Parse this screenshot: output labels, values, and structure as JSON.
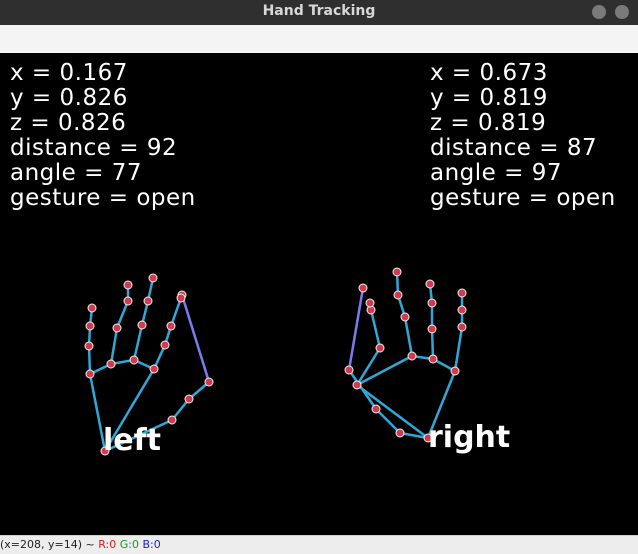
{
  "window": {
    "title": "Hand Tracking"
  },
  "left_stats": {
    "x": "x = 0.167",
    "y": "y = 0.826",
    "z": "z = 0.826",
    "distance": "distance = 92",
    "angle": "angle = 77",
    "gesture": "gesture = open"
  },
  "right_stats": {
    "x": "x = 0.673",
    "y": "y = 0.819",
    "z": "z = 0.819",
    "distance": "distance = 87",
    "angle": "angle = 97",
    "gesture": "gesture = open"
  },
  "hands": {
    "left_label": "left",
    "right_label": "right"
  },
  "status": {
    "coords": "(x=208, y=14) ~ ",
    "r": "R:0",
    "g": "G:0",
    "b": "B:0"
  },
  "colors": {
    "bone": "#2fa8d8",
    "joint": "#d23a4e",
    "joint_ring": "#f2f2f2",
    "thumb_link": "#7b7bf0",
    "status_r": "#d22020",
    "status_g": "#1a9a1a",
    "status_b": "#2020d2"
  }
}
